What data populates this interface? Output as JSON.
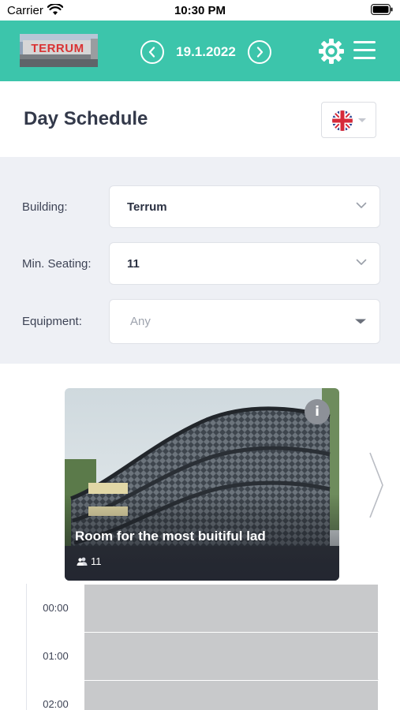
{
  "status_bar": {
    "carrier": "Carrier",
    "time": "10:30 PM"
  },
  "header": {
    "logo_text": "TERRUM",
    "date": "19.1.2022",
    "accent_color": "#3cc5ab",
    "icons": [
      "chevron-left-icon",
      "chevron-right-icon",
      "gear-icon",
      "hamburger-menu-icon"
    ]
  },
  "page": {
    "title": "Day Schedule",
    "language_flag": "uk-flag-icon"
  },
  "filters": {
    "building_label": "Building:",
    "building_value": "Terrum",
    "seating_label": "Min. Seating:",
    "seating_value": "11",
    "equipment_label": "Equipment:",
    "equipment_placeholder": "Any"
  },
  "room": {
    "name": "Room for the most buitiful lad",
    "seats": "11",
    "info_label": "i"
  },
  "schedule": {
    "slots": [
      {
        "time": "00:00"
      },
      {
        "time": "01:00"
      },
      {
        "time": "02:00"
      }
    ]
  }
}
